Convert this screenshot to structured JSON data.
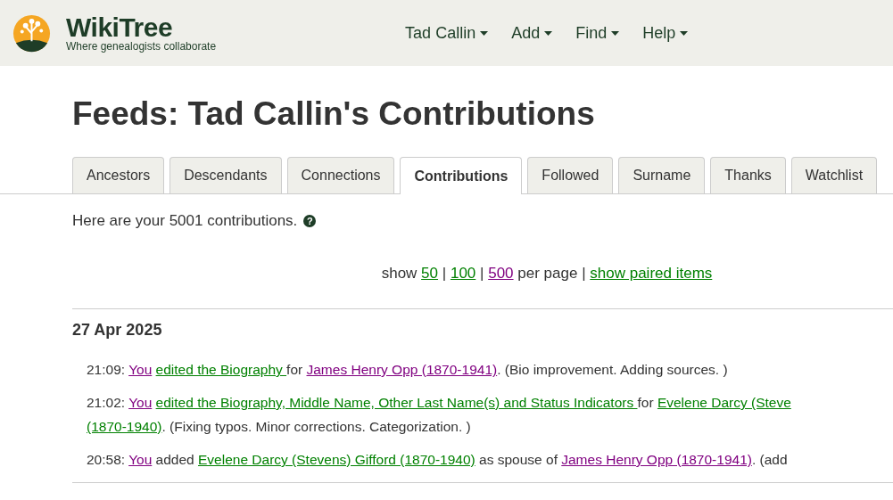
{
  "header": {
    "logo_title": "WikiTree",
    "logo_tagline": "Where genealogists collaborate",
    "menu": [
      "Tad Callin",
      "Add",
      "Find",
      "Help"
    ]
  },
  "page_title": "Feeds: Tad Callin's Contributions",
  "tabs": [
    {
      "label": "Ancestors",
      "selected": false
    },
    {
      "label": "Descendants",
      "selected": false
    },
    {
      "label": "Connections",
      "selected": false
    },
    {
      "label": "Contributions",
      "selected": true
    },
    {
      "label": "Followed",
      "selected": false
    },
    {
      "label": "Surname",
      "selected": false
    },
    {
      "label": "Thanks",
      "selected": false
    },
    {
      "label": "Watchlist",
      "selected": false
    }
  ],
  "summary": {
    "text": "Here are your 5001 contributions.",
    "help_glyph": "?"
  },
  "paging": [
    {
      "kind": "text",
      "text": "show"
    },
    {
      "kind": "link",
      "text": "50",
      "visited": false
    },
    {
      "kind": "text",
      "text": "|"
    },
    {
      "kind": "link",
      "text": "100",
      "visited": false
    },
    {
      "kind": "text",
      "text": "|"
    },
    {
      "kind": "link",
      "text": "500",
      "visited": true
    },
    {
      "kind": "text",
      "text": "per page |"
    },
    {
      "kind": "link",
      "text": "show paired items",
      "visited": false
    }
  ],
  "days": [
    {
      "date": "27 Apr 2025",
      "entries": [
        {
          "lines": [
            [
              {
                "kind": "text",
                "text": "21:09: "
              },
              {
                "kind": "link",
                "text": "You",
                "visited": true
              },
              {
                "kind": "space"
              },
              {
                "kind": "link",
                "text": "edited the Biography ",
                "visited": false
              },
              {
                "kind": "text",
                "text": "for "
              },
              {
                "kind": "link",
                "text": "James Henry Opp (1870-1941)",
                "visited": true
              },
              {
                "kind": "text",
                "text": ". (Bio improvement. Adding sources. )"
              }
            ]
          ]
        },
        {
          "lines": [
            [
              {
                "kind": "text",
                "text": "21:02: "
              },
              {
                "kind": "link",
                "text": "You",
                "visited": true
              },
              {
                "kind": "space"
              },
              {
                "kind": "link",
                "text": "edited the Biography, Middle Name, Other Last Name(s) and Status Indicators ",
                "visited": false
              },
              {
                "kind": "text",
                "text": "for "
              },
              {
                "kind": "link",
                "text": "Evelene Darcy (Steve",
                "visited": false
              }
            ],
            [
              {
                "kind": "link",
                "text": "(1870-1940)",
                "visited": false
              },
              {
                "kind": "text",
                "text": ". (Fixing typos. Minor corrections. Categorization. )"
              }
            ]
          ]
        },
        {
          "lines": [
            [
              {
                "kind": "text",
                "text": "20:58: "
              },
              {
                "kind": "link",
                "text": "You",
                "visited": true
              },
              {
                "kind": "text",
                "text": " added "
              },
              {
                "kind": "link",
                "text": "Evelene Darcy (Stevens) Gifford (1870-1940)",
                "visited": false
              },
              {
                "kind": "text",
                "text": " as spouse of "
              },
              {
                "kind": "link",
                "text": "James Henry Opp (1870-1941)",
                "visited": true
              },
              {
                "kind": "text",
                "text": ". (add"
              }
            ]
          ]
        }
      ]
    }
  ]
}
